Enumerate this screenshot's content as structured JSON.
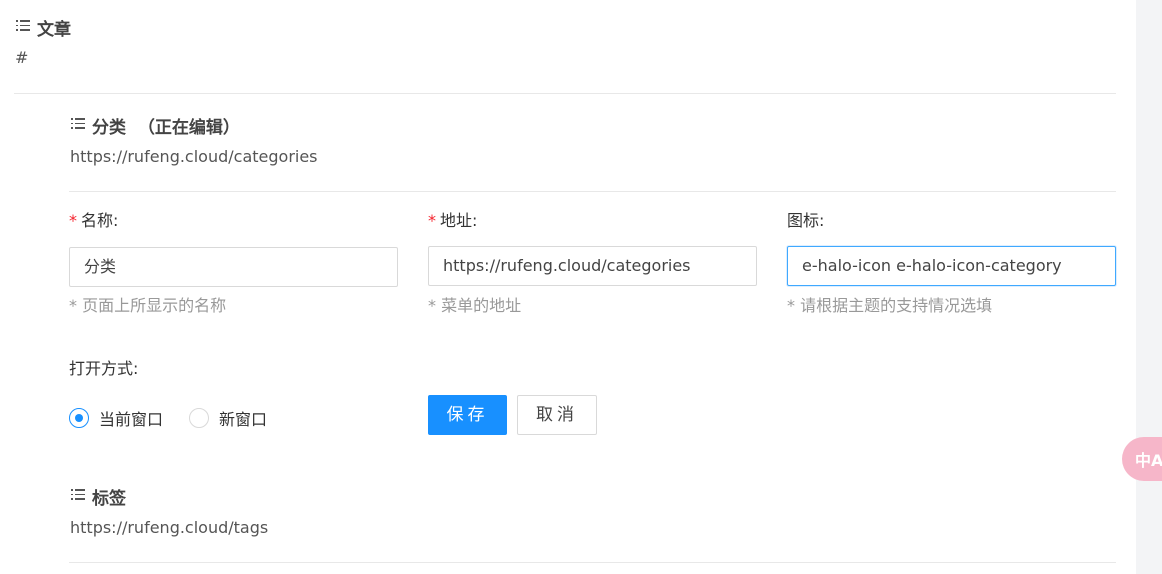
{
  "sections": {
    "article": {
      "title": "文章",
      "url": "#"
    },
    "category": {
      "title": "分类",
      "editing_label": "（正在编辑）",
      "url": "https://rufeng.cloud/categories"
    },
    "tags": {
      "title": "标签",
      "url": "https://rufeng.cloud/tags"
    }
  },
  "form": {
    "name": {
      "required_mark": "*",
      "label": "名称:",
      "value": "分类",
      "hint": "* 页面上所显示的名称"
    },
    "address": {
      "required_mark": "*",
      "label": "地址:",
      "value": "https://rufeng.cloud/categories",
      "hint": "* 菜单的地址"
    },
    "icon": {
      "label": "图标:",
      "value": "e-halo-icon e-halo-icon-category",
      "hint": "* 请根据主题的支持情况选填"
    },
    "open_mode": {
      "label": "打开方式:",
      "options": [
        "当前窗口",
        "新窗口"
      ],
      "selected": "当前窗口"
    },
    "save_label": "保存",
    "cancel_label": "取消"
  },
  "translate_widget": {
    "label": "中A",
    "icon": "translate-icon"
  },
  "colors": {
    "primary": "#1890ff",
    "required": "#f5222d",
    "hint": "#999999"
  }
}
